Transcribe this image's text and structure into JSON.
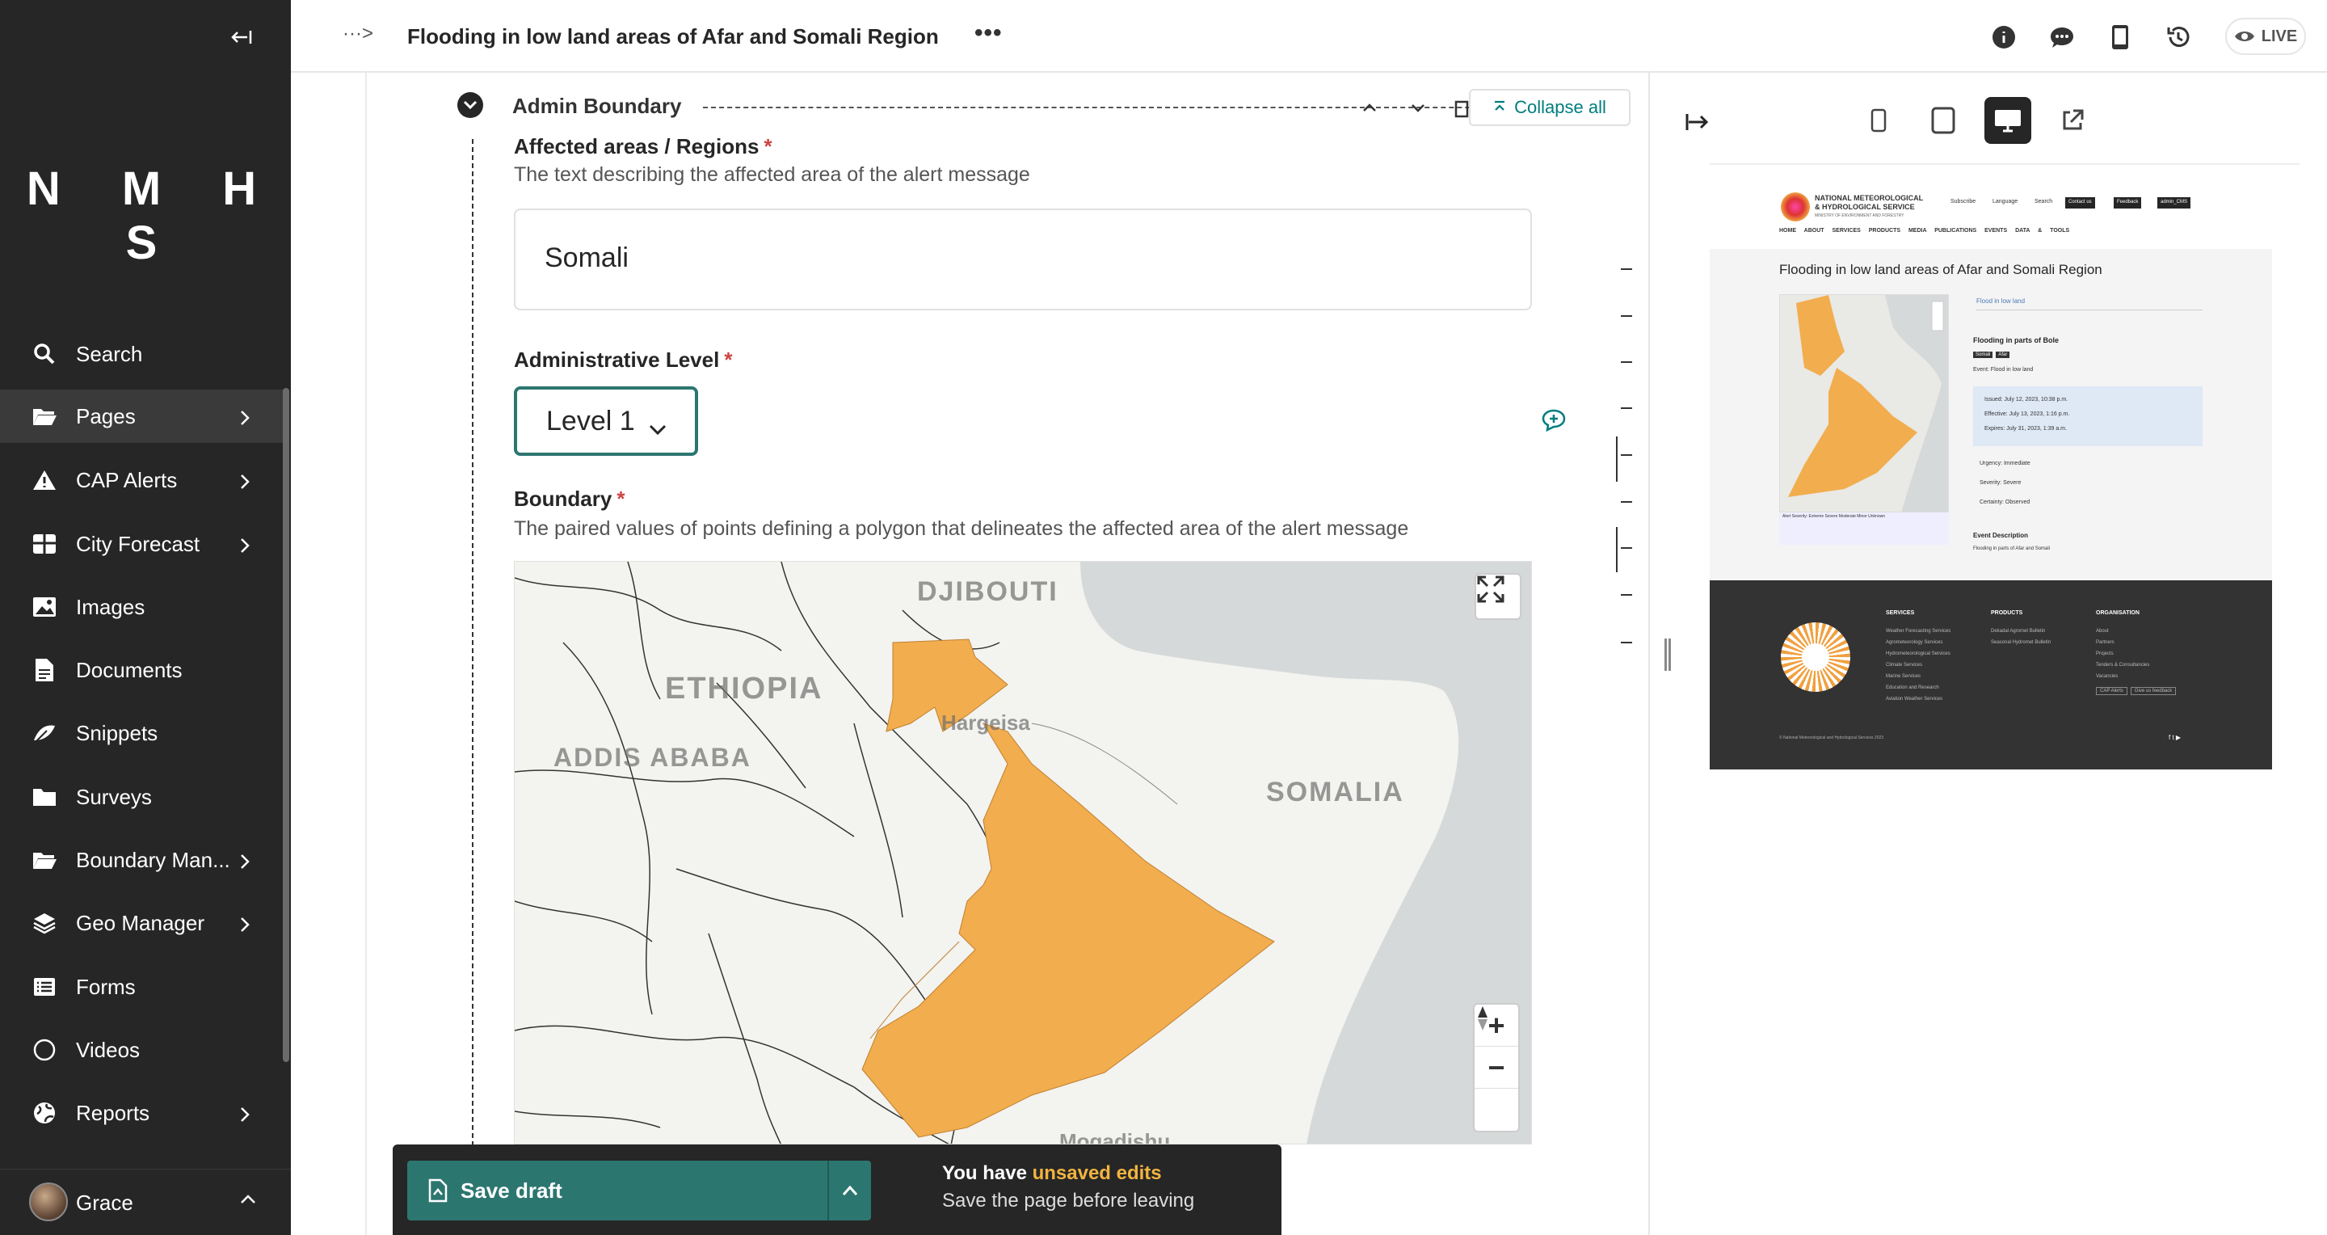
{
  "sidebar": {
    "logo": "N M H S",
    "items": [
      {
        "label": "Search",
        "icon": "search-icon",
        "has_children": false
      },
      {
        "label": "Pages",
        "icon": "folder-open-icon",
        "has_children": true
      },
      {
        "label": "CAP Alerts",
        "icon": "warning-icon",
        "has_children": true
      },
      {
        "label": "City Forecast",
        "icon": "table-icon",
        "has_children": true
      },
      {
        "label": "Images",
        "icon": "image-icon",
        "has_children": false
      },
      {
        "label": "Documents",
        "icon": "document-icon",
        "has_children": false
      },
      {
        "label": "Snippets",
        "icon": "snippet-icon",
        "has_children": false
      },
      {
        "label": "Surveys",
        "icon": "folder-icon",
        "has_children": false
      },
      {
        "label": "Boundary Man...",
        "icon": "folder-open-icon",
        "has_children": true
      },
      {
        "label": "Geo Manager",
        "icon": "layers-icon",
        "has_children": true
      },
      {
        "label": "Forms",
        "icon": "list-icon",
        "has_children": false
      },
      {
        "label": "Videos",
        "icon": "circle-icon",
        "has_children": false
      },
      {
        "label": "Reports",
        "icon": "globe-icon",
        "has_children": true
      }
    ],
    "user": {
      "name": "Grace"
    }
  },
  "header": {
    "breadcrumb": "···>",
    "title": "Flooding in low land areas of Afar and Somali Region",
    "more": "•••",
    "live_label": "LIVE"
  },
  "editor": {
    "section_title": "Admin Boundary",
    "collapse_all": "Collapse all",
    "affected": {
      "label": "Affected areas / Regions",
      "required": "*",
      "help": "The text describing the affected area of the alert message",
      "value": "Somali"
    },
    "admin_level": {
      "label": "Administrative Level",
      "required": "*",
      "value": "Level 1"
    },
    "boundary": {
      "label": "Boundary",
      "required": "*",
      "help": "The paired values of points defining a polygon that delineates the affected area of the alert message"
    },
    "map": {
      "labels": [
        "DJIBOUTI",
        "ETHIOPIA",
        "ADDIS ABABA",
        "SOMALIA",
        "Hargeisa",
        "Mogadishu"
      ],
      "fill_color": "#f2ad4e",
      "zoom_in": "+",
      "zoom_out": "−"
    }
  },
  "save_bar": {
    "save_label": "Save draft",
    "unsaved_prefix": "You have ",
    "unsaved_highlight": "unsaved edits",
    "unsaved_sub": "Save the page before leaving"
  },
  "preview": {
    "site": {
      "org_line1": "NATIONAL METEOROLOGICAL",
      "org_line2": "& HYDROLOGICAL SERVICE",
      "org_line3": "MINISTRY OF ENVIRONMENT AND FORESTRY",
      "top_links": [
        "Subscribe",
        "Language",
        "Search"
      ],
      "top_buttons": [
        "Contact us",
        "Feedback",
        "admin_CMS"
      ],
      "nav": "HOME ABOUT SERVICES PRODUCTS MEDIA PUBLICATIONS EVENTS DATA & TOOLS",
      "title": "Flooding in low land areas of Afar and Somali Region",
      "tab": "Flood in low land",
      "card_title": "Flooding in parts of Bole",
      "tags": [
        "Somali",
        "Afar"
      ],
      "event": "Event:    Flood in low land",
      "issued": "Issued: July 12, 2023, 10:38 p.m.",
      "effective": "Effective: July 13, 2023, 1:16 p.m.",
      "expires": "Expires: July 31, 2023, 1:39 a.m.",
      "urgency": "Urgency: Immediate",
      "severity": "Severity: Severe",
      "certainty": "Certainty: Observed",
      "legend": "Alert Severity:  Extreme  Severe  Moderate  Minor  Unknown",
      "event_desc_title": "Event Description",
      "event_desc": "Flooding in parts of Afar and Somali",
      "footer": {
        "services_title": "SERVICES",
        "services": [
          "Weather Forecasting Services",
          "Agrometeorology Services",
          "Hydrometeorological Services",
          "Climate Services",
          "Marine Services",
          "Education and Research",
          "Aviation Weather Services"
        ],
        "products_title": "PRODUCTS",
        "products": [
          "Dekadal Agromet Bulletin",
          "Seasonal Hydromet Bulletin"
        ],
        "org_title": "ORGANISATION",
        "org": [
          "About",
          "Partners",
          "Projects",
          "Tenders & Consultancies",
          "Vacancies"
        ],
        "buttons": [
          "CAP Alerts",
          "Give us feedback"
        ],
        "copyright": "© National Meteorological and Hydrological Services 2023",
        "social": "f t ▶"
      }
    }
  }
}
